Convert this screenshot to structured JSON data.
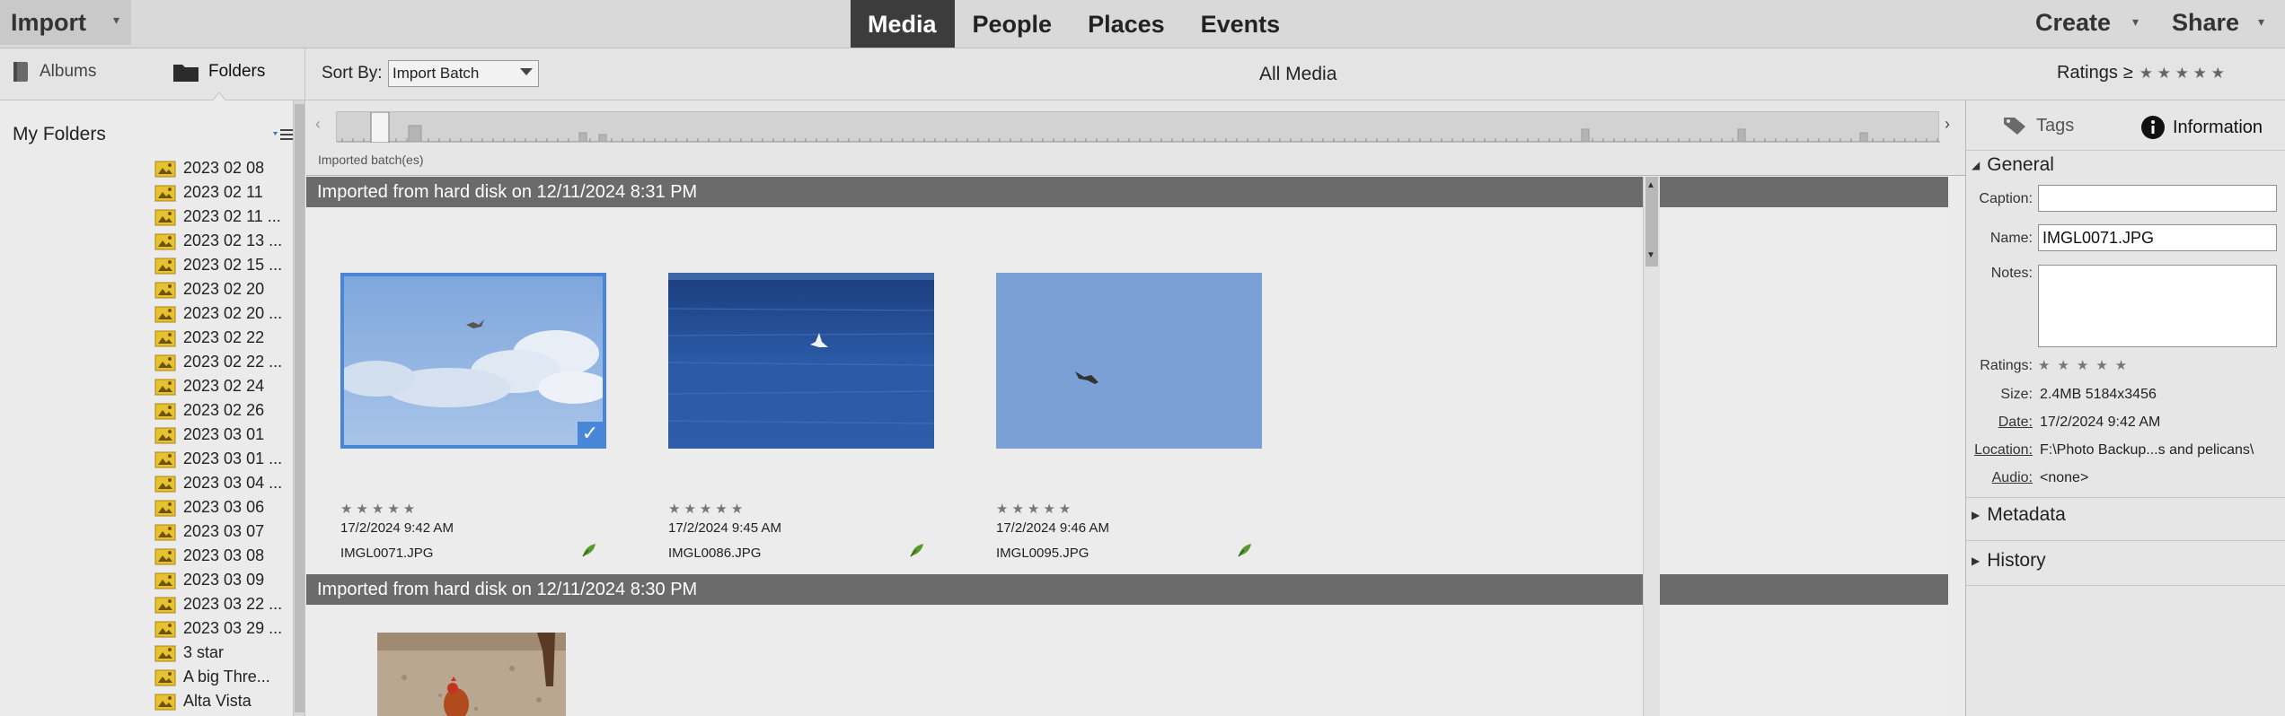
{
  "topbar": {
    "import_label": "Import",
    "view_tabs": [
      {
        "label": "Media",
        "active": true
      },
      {
        "label": "People",
        "active": false
      },
      {
        "label": "Places",
        "active": false
      },
      {
        "label": "Events",
        "active": false
      }
    ],
    "create_label": "Create",
    "share_label": "Share"
  },
  "subbar": {
    "albums_label": "Albums",
    "folders_label": "Folders",
    "sort_by_label": "Sort By:",
    "sort_value": "Import Batch",
    "all_media_label": "All Media",
    "ratings_label": "Ratings",
    "ratings_operator": "≥",
    "ratings_stars": "★ ★ ★ ★ ★"
  },
  "folders": {
    "title": "My Folders",
    "items": [
      "2023 02 08",
      "2023 02 11",
      "2023 02 11 ...",
      "2023 02 13 ...",
      "2023 02 15 ...",
      "2023 02 20",
      "2023 02 20 ...",
      "2023 02 22",
      "2023 02 22 ...",
      "2023 02 24",
      "2023 02 26",
      "2023 03 01",
      "2023 03 01 ...",
      "2023 03 04 ...",
      "2023 03 06",
      "2023 03 07",
      "2023 03 08",
      "2023 03 09",
      "2023 03 22 ...",
      "2023 03 29 ...",
      "3 star",
      "A  big Thre...",
      "Alta Vista"
    ]
  },
  "timeline": {
    "label": "Imported batch(es)",
    "left_arrow": "‹",
    "right_arrow": "›"
  },
  "batches": [
    {
      "header": "Imported from hard disk on 12/11/2024 8:31 PM",
      "items": [
        {
          "date": "17/2/2024 9:42 AM",
          "name": "IMGL0071.JPG",
          "stars": "★★★★★",
          "selected": true
        },
        {
          "date": "17/2/2024 9:45 AM",
          "name": "IMGL0086.JPG",
          "stars": "★★★★★",
          "selected": false
        },
        {
          "date": "17/2/2024 9:46 AM",
          "name": "IMGL0095.JPG",
          "stars": "★★★★★",
          "selected": false
        }
      ]
    },
    {
      "header": "Imported from hard disk on 12/11/2024 8:30 PM",
      "items": []
    }
  ],
  "info_panel": {
    "tags_tab": "Tags",
    "info_tab": "Information",
    "general_label": "General",
    "caption_label": "Caption:",
    "caption_value": "",
    "name_label": "Name:",
    "name_value": "IMGL0071.JPG",
    "notes_label": "Notes:",
    "ratings_label": "Ratings:",
    "ratings_stars": "★★★★★",
    "size_label": "Size:",
    "size_value": "2.4MB  5184x3456",
    "date_label": "Date:",
    "date_value": "17/2/2024 9:42 AM",
    "location_label": "Location:",
    "location_value": "F:\\Photo Backup...s and pelicans\\",
    "audio_label": "Audio:",
    "audio_value": "<none>",
    "metadata_label": "Metadata",
    "history_label": "History"
  },
  "colors": {
    "active_tab_bg": "#3c3c3c",
    "batch_header_bg": "#6b6b6b",
    "selection_blue": "#4a86d8",
    "folder_icon_yellow": "#e8c12f"
  }
}
